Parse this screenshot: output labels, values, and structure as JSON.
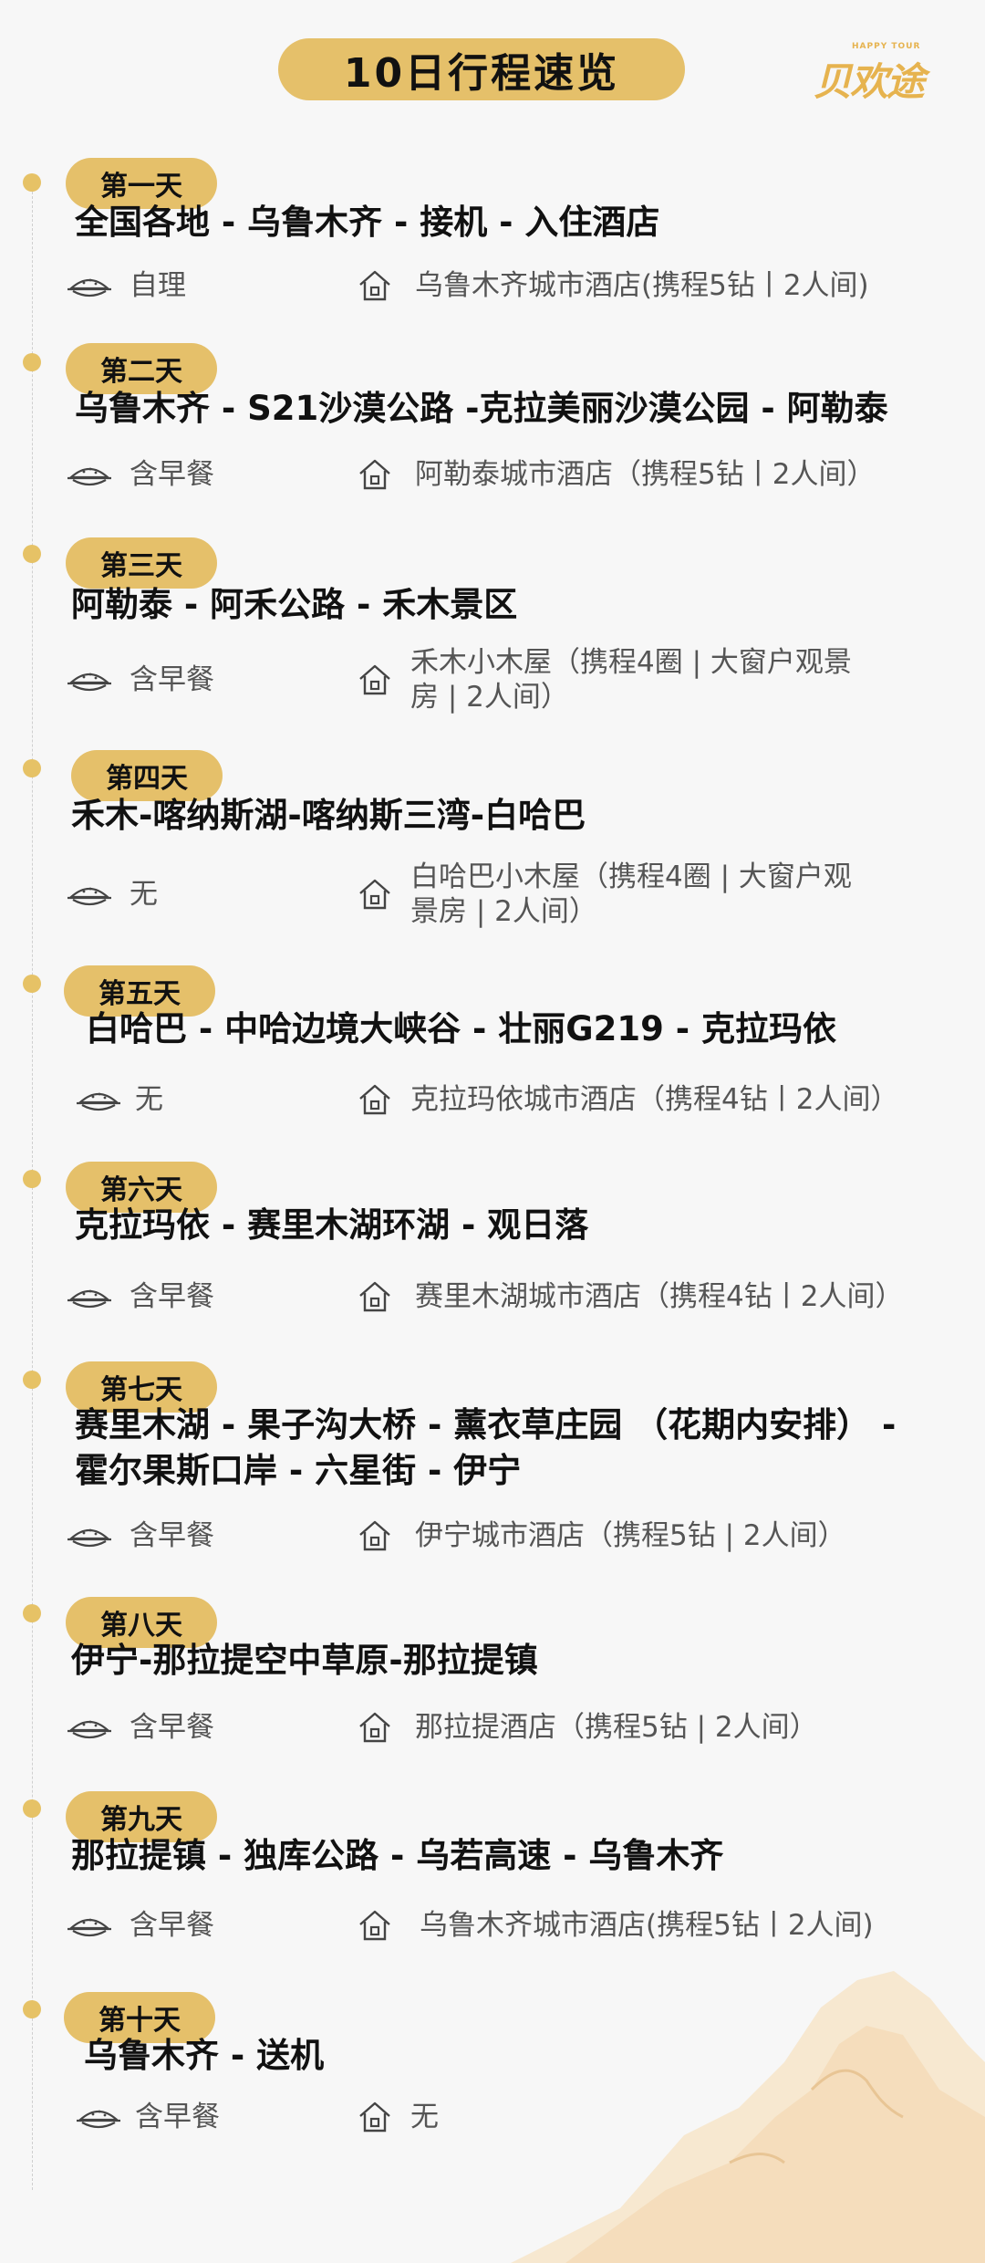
{
  "header": {
    "title": "10日行程速览",
    "logo_text": "贝欢途",
    "logo_sub": "HAPPY TOUR"
  },
  "icons": {
    "meal": "rice-bowl-icon",
    "hotel": "house-icon",
    "marker": "timeline-dot-icon"
  },
  "colors": {
    "accent": "#e5c06a",
    "dot": "#e6c266",
    "text": "#111111",
    "muted": "#555555",
    "background": "#f7f7f7"
  },
  "days": [
    {
      "label": "第一天",
      "route": [
        "全国各地 - 乌鲁木齐 - 接机 - 入住酒店"
      ],
      "meal": "自理",
      "hotel": [
        "乌鲁木齐城市酒店(携程5钻丨2人间)"
      ]
    },
    {
      "label": "第二天",
      "route": [
        "乌鲁木齐 - S21沙漠公路 -克拉美丽沙漠公园 - 阿勒泰"
      ],
      "meal": "含早餐",
      "hotel": [
        "阿勒泰城市酒店（携程5钻丨2人间）"
      ]
    },
    {
      "label": "第三天",
      "route": [
        "阿勒泰 - 阿禾公路 - 禾木景区"
      ],
      "meal": "含早餐",
      "hotel": [
        "禾木小木屋（携程4圈 | 大窗户观景",
        "房 | 2人间）"
      ]
    },
    {
      "label": "第四天",
      "route": [
        "禾木-喀纳斯湖-喀纳斯三湾-白哈巴"
      ],
      "meal": "无",
      "hotel": [
        "白哈巴小木屋（携程4圈 | 大窗户观",
        "景房 | 2人间）"
      ]
    },
    {
      "label": "第五天",
      "route": [
        "白哈巴 - 中哈边境大峡谷 - 壮丽G219 - 克拉玛依"
      ],
      "meal": "无",
      "hotel": [
        "克拉玛依城市酒店（携程4钻丨2人间）"
      ]
    },
    {
      "label": "第六天",
      "route": [
        "克拉玛依 - 赛里木湖环湖 - 观日落"
      ],
      "meal": "含早餐",
      "hotel": [
        "赛里木湖城市酒店（携程4钻丨2人间）"
      ]
    },
    {
      "label": "第七天",
      "route": [
        "赛里木湖 - 果子沟大桥 - 薰衣草庄园 （花期内安排） -",
        "霍尔果斯口岸 - 六星街 - 伊宁"
      ],
      "meal": "含早餐",
      "hotel": [
        "伊宁城市酒店（携程5钻 | 2人间）"
      ]
    },
    {
      "label": "第八天",
      "route": [
        "伊宁-那拉提空中草原-那拉提镇"
      ],
      "meal": "含早餐",
      "hotel": [
        "那拉提酒店（携程5钻 | 2人间）"
      ]
    },
    {
      "label": "第九天",
      "route": [
        "那拉提镇 - 独库公路 - 乌若高速 - 乌鲁木齐"
      ],
      "meal": "含早餐",
      "hotel": [
        "乌鲁木齐城市酒店(携程5钻丨2人间)"
      ]
    },
    {
      "label": "第十天",
      "route": [
        "乌鲁木齐 - 送机"
      ],
      "meal": "含早餐",
      "hotel": [
        "无"
      ]
    }
  ]
}
